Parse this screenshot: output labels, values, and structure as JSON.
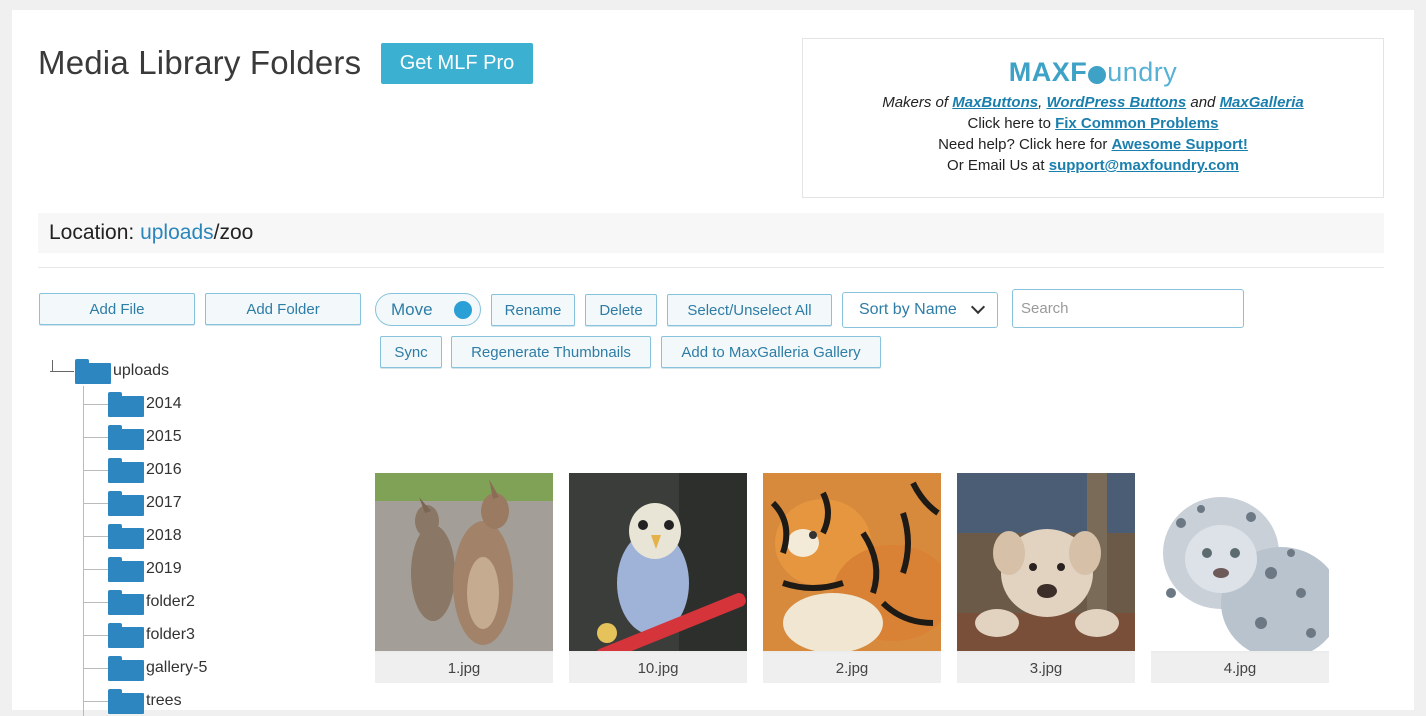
{
  "header": {
    "title": "Media Library Folders",
    "pro_button": "Get MLF Pro"
  },
  "promo": {
    "logo_a": "MAXF",
    "logo_b": "undry",
    "line1_prefix": "Makers of ",
    "maxbuttons": "MaxButtons",
    "comma": ", ",
    "wpbuttons": "WordPress Buttons",
    "and": " and ",
    "maxgalleria": "MaxGalleria",
    "line2_prefix": "Click here to ",
    "fix": "Fix Common Problems",
    "line3_prefix": "Need help? Click here for ",
    "support": "Awesome Support!",
    "line4_prefix": "Or Email Us at ",
    "email": "support@maxfoundry.com"
  },
  "location": {
    "label": "Location: ",
    "root": "uploads",
    "path": "/zoo"
  },
  "toolbar": {
    "add_file": "Add File",
    "add_folder": "Add Folder",
    "move": "Move",
    "rename": "Rename",
    "delete": "Delete",
    "select_all": "Select/Unselect All",
    "sort": "Sort by Name",
    "search_placeholder": "Search",
    "sync": "Sync",
    "regen": "Regenerate Thumbnails",
    "add_gallery": "Add to MaxGalleria Gallery"
  },
  "tree": {
    "root": "uploads",
    "folders": [
      "2014",
      "2015",
      "2016",
      "2017",
      "2018",
      "2019",
      "folder2",
      "folder3",
      "gallery-5",
      "trees"
    ]
  },
  "files": [
    {
      "name": "1.jpg",
      "icon": "kangaroo-image"
    },
    {
      "name": "10.jpg",
      "icon": "budgie-image"
    },
    {
      "name": "2.jpg",
      "icon": "tiger-image"
    },
    {
      "name": "3.jpg",
      "icon": "puppy-image"
    },
    {
      "name": "4.jpg",
      "icon": "snow-leopard-image"
    }
  ],
  "colors": {
    "accent": "#3bb0d0",
    "link": "#2a86ba",
    "folder": "#2e86c1"
  }
}
